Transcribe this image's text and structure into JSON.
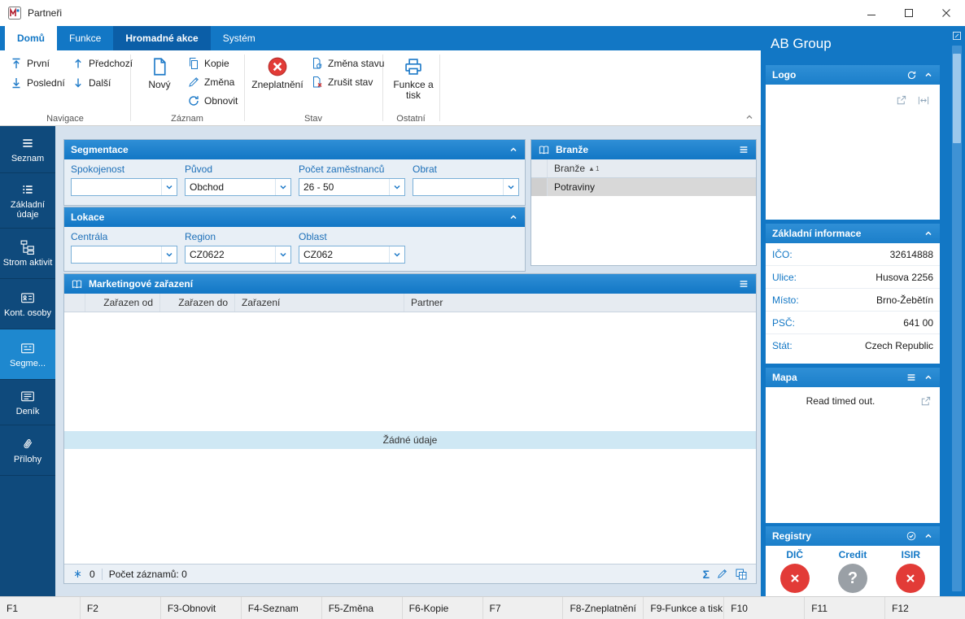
{
  "window": {
    "title": "Partneři"
  },
  "tabs": [
    {
      "label": "Domů"
    },
    {
      "label": "Funkce"
    },
    {
      "label": "Hromadné akce"
    },
    {
      "label": "Systém"
    }
  ],
  "ribbon": {
    "groups": {
      "navigace": "Navigace",
      "zaznam": "Záznam",
      "stav": "Stav",
      "ostatni": "Ostatní"
    },
    "buttons": {
      "prvni": "První",
      "posledni": "Poslední",
      "predchozi": "Předchozí",
      "dalsi": "Další",
      "novy": "Nový",
      "kopie": "Kopie",
      "zmena": "Změna",
      "obnovit": "Obnovit",
      "zneplatneni": "Zneplatnění",
      "zmena_stavu": "Změna stavu",
      "zrusit_stav": "Zrušit stav",
      "funkce_a_tisk": "Funkce a tisk"
    }
  },
  "sidebar": {
    "items": [
      {
        "label": "Seznam"
      },
      {
        "label": "Základní údaje"
      },
      {
        "label": "Strom aktivit"
      },
      {
        "label": "Kont. osoby"
      },
      {
        "label": "Segme...",
        "active": true
      },
      {
        "label": "Deník"
      },
      {
        "label": "Přílohy"
      }
    ]
  },
  "segmentace": {
    "title": "Segmentace",
    "fields": [
      {
        "label": "Spokojenost",
        "value": ""
      },
      {
        "label": "Původ",
        "value": "Obchod"
      },
      {
        "label": "Počet zaměstnanců",
        "value": "26 - 50"
      },
      {
        "label": "Obrat",
        "value": ""
      }
    ]
  },
  "lokace": {
    "title": "Lokace",
    "fields": [
      {
        "label": "Centrála",
        "value": ""
      },
      {
        "label": "Region",
        "value": "CZ0622"
      },
      {
        "label": "Oblast",
        "value": "CZ062"
      }
    ]
  },
  "branze": {
    "title": "Branže",
    "column": "Branže",
    "sort_index": "1",
    "rows": [
      {
        "value": "Potraviny"
      }
    ]
  },
  "marketing": {
    "title": "Marketingové zařazení",
    "columns": [
      "Zařazen od",
      "Zařazen do",
      "Zařazení",
      "Partner"
    ],
    "empty_text": "Žádné údaje",
    "footer": {
      "count": "0",
      "records_label": "Počet záznamů: 0"
    }
  },
  "detail": {
    "title": "AB Group",
    "logo": {
      "title": "Logo"
    },
    "info": {
      "title": "Základní informace",
      "rows": [
        {
          "label": "IČO:",
          "value": "32614888"
        },
        {
          "label": "Ulice:",
          "value": "Husova 2256"
        },
        {
          "label": "Místo:",
          "value": "Brno-Žebětín"
        },
        {
          "label": "PSČ:",
          "value": "641 00"
        },
        {
          "label": "Stát:",
          "value": "Czech Republic"
        }
      ]
    },
    "mapa": {
      "title": "Mapa",
      "message": "Read timed out."
    },
    "registry": {
      "title": "Registry",
      "items": [
        {
          "label": "DIČ",
          "status": "error"
        },
        {
          "label": "Credit",
          "status": "unknown"
        },
        {
          "label": "ISIR",
          "status": "error"
        }
      ]
    }
  },
  "fkeys": [
    {
      "label": "F1"
    },
    {
      "label": "F2"
    },
    {
      "label": "F3-Obnovit"
    },
    {
      "label": "F4-Seznam"
    },
    {
      "label": "F5-Změna"
    },
    {
      "label": "F6-Kopie"
    },
    {
      "label": "F7"
    },
    {
      "label": "F8-Zneplatnění"
    },
    {
      "label": "F9-Funkce a tisk"
    },
    {
      "label": "F10"
    },
    {
      "label": "F11"
    },
    {
      "label": "F12"
    }
  ],
  "colors": {
    "accent": "#1277c5",
    "sidebar": "#0f4a7c",
    "error": "#e23b37",
    "unknown": "#9aa0a6"
  }
}
